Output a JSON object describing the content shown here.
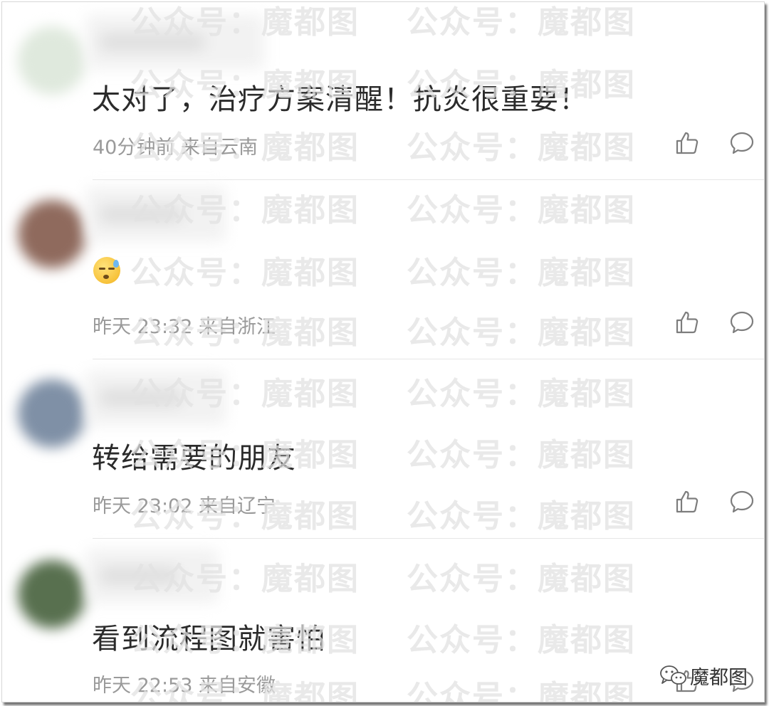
{
  "watermark": "公众号：魔都图",
  "brand": {
    "label": "魔都图"
  },
  "comments": [
    {
      "text": "太对了，治疗方案清醒！抗炎很重要！",
      "meta": "40分钟前 来自云南",
      "avatar_color": "#dfe9dd"
    },
    {
      "text": "",
      "emoji": "sleepy-sweat-emoji",
      "meta": "昨天 23:32 来自浙江",
      "avatar_color": "#8f6a5d"
    },
    {
      "text": "转给需要的朋友",
      "meta": "昨天 23:02 来自辽宁",
      "avatar_color": "#7f90a6"
    },
    {
      "text": "看到流程图就害怕",
      "meta": "昨天 22:53 来自安徽",
      "avatar_color": "#58704f"
    }
  ],
  "icons": {
    "like": "thumbs-up-icon",
    "reply": "comment-bubble-icon",
    "brand": "wechat-icon"
  }
}
